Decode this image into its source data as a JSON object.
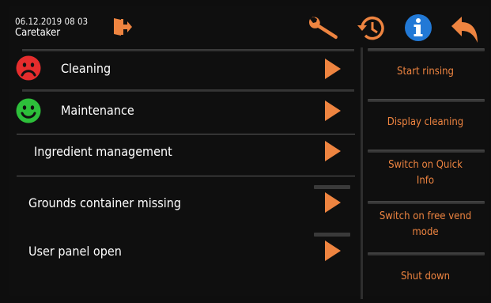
{
  "header": {
    "datetime": "06.12.2019 08 03",
    "user": "Caretaker",
    "icons": [
      "exit-door-icon",
      "wrench-icon",
      "history-clock-icon",
      "info-icon",
      "back-arrow-icon"
    ]
  },
  "list": {
    "rows": [
      {
        "label": "Cleaning",
        "status": "red-sad"
      },
      {
        "label": "Maintenance",
        "status": "green-happy"
      },
      {
        "label": "Ingredient management"
      },
      {
        "label": "Grounds container missing"
      },
      {
        "label": "User panel open"
      }
    ]
  },
  "actions": {
    "start_rinsing": "Start rinsing",
    "display_cleaning": "Display cleaning",
    "quick_info_line1": "Switch on Quick",
    "quick_info_line2": "Info",
    "free_vend_line1": "Switch on free vend",
    "free_vend_line2": "mode",
    "shut_down": "Shut down"
  },
  "colors": {
    "accent": "#ee8440",
    "background": "#0f0f0f",
    "sad_face": "#e52d2d",
    "happy_face": "#2dbf3a",
    "info": "#2279d6"
  }
}
